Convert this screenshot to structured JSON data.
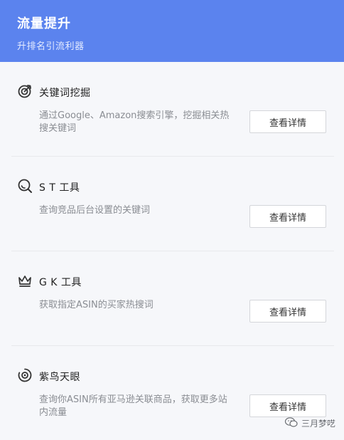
{
  "header": {
    "title": "流量提升",
    "subtitle": "升排名引流利器"
  },
  "tools": [
    {
      "icon": "target-icon",
      "title": "关键词挖掘",
      "description": "通过Google、Amazon搜索引擎，挖掘相关热搜关键词",
      "button_label": "查看详情"
    },
    {
      "icon": "search-icon",
      "title": "S T 工具",
      "description": "查询竞品后台设置的关键词",
      "button_label": "查看详情"
    },
    {
      "icon": "crown-icon",
      "title": "G K 工具",
      "description": "获取指定ASIN的买家热搜词",
      "button_label": "查看详情"
    },
    {
      "icon": "eye-icon",
      "title": "紫鸟天眼",
      "description": "查询你ASIN所有亚马逊关联商品，获取更多站内流量",
      "button_label": "查看详情"
    }
  ],
  "watermark": {
    "text": "三月梦呓"
  },
  "colors": {
    "header_bg": "#5b83ee",
    "panel_bg": "#f6f7fa"
  }
}
